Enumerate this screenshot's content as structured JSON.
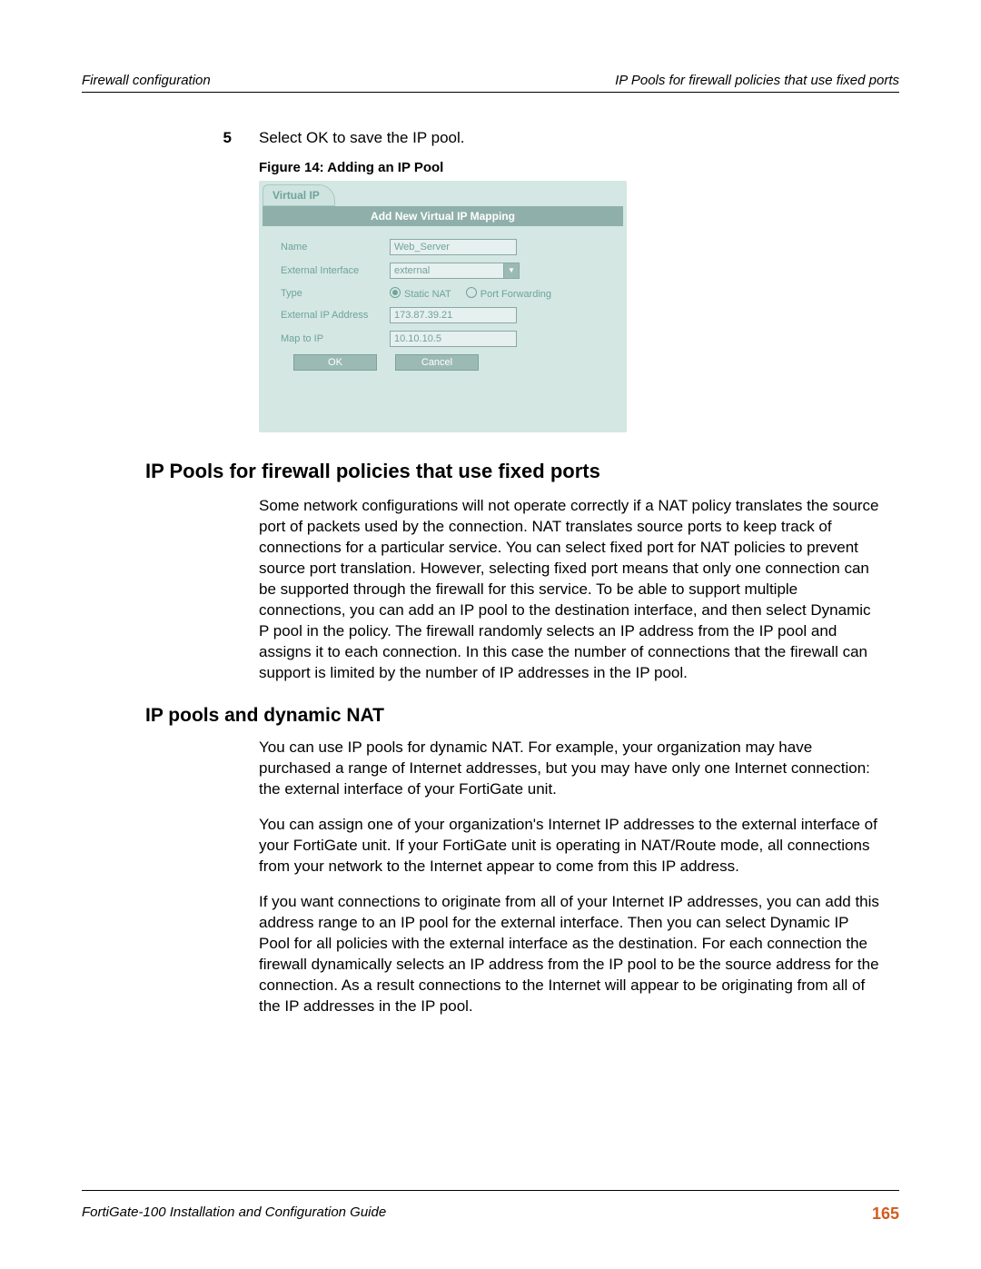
{
  "header": {
    "left": "Firewall configuration",
    "right": "IP Pools for firewall policies that use fixed ports"
  },
  "step": {
    "num": "5",
    "text": "Select OK to save the IP pool."
  },
  "figure": {
    "caption": "Figure 14: Adding an IP Pool",
    "tab": "Virtual IP",
    "title": "Add New Virtual IP Mapping",
    "labels": {
      "name": "Name",
      "ext_if": "External Interface",
      "type": "Type",
      "ext_ip": "External IP Address",
      "map": "Map to IP"
    },
    "values": {
      "name": "Web_Server",
      "ext_if": "external",
      "type_static": "Static NAT",
      "type_portfwd": "Port Forwarding",
      "ext_ip": "173.87.39.21",
      "map": "10.10.10.5"
    },
    "buttons": {
      "ok": "OK",
      "cancel": "Cancel"
    }
  },
  "sections": {
    "h1": "IP Pools for firewall policies that use fixed ports",
    "p1": "Some network configurations will not operate correctly if a NAT policy translates the source port of packets used by the connection. NAT translates source ports to keep track of connections for a particular service. You can select fixed port for NAT policies to prevent source port translation. However, selecting fixed port means that only one connection can be supported through the firewall for this service. To be able to support multiple connections, you can add an IP pool to the destination interface, and then select Dynamic P pool in the policy. The firewall randomly selects an IP address from the IP pool and assigns it to each connection. In this case the number of connections that the firewall can support is limited by the number of IP addresses in the IP pool.",
    "h2": "IP pools and dynamic NAT",
    "p2": "You can use IP pools for dynamic NAT. For example, your organization may have purchased a range of Internet addresses, but you may have only one Internet connection: the external interface of your FortiGate unit.",
    "p3": "You can assign one of your organization's Internet IP addresses to the external interface of your FortiGate unit. If your FortiGate unit is operating in NAT/Route mode, all connections from your network to the Internet appear to come from this IP address.",
    "p4": "If you want connections to originate from all of your Internet IP addresses, you can add this address range to an IP pool for the external interface. Then you can select Dynamic IP Pool for all policies with the external interface as the destination. For each connection the firewall dynamically selects an IP address from the IP pool to be the source address for the connection. As a result connections to the Internet will appear to be originating from all of the IP addresses in the IP pool."
  },
  "footer": {
    "left": "FortiGate-100 Installation and Configuration Guide",
    "page": "165"
  }
}
